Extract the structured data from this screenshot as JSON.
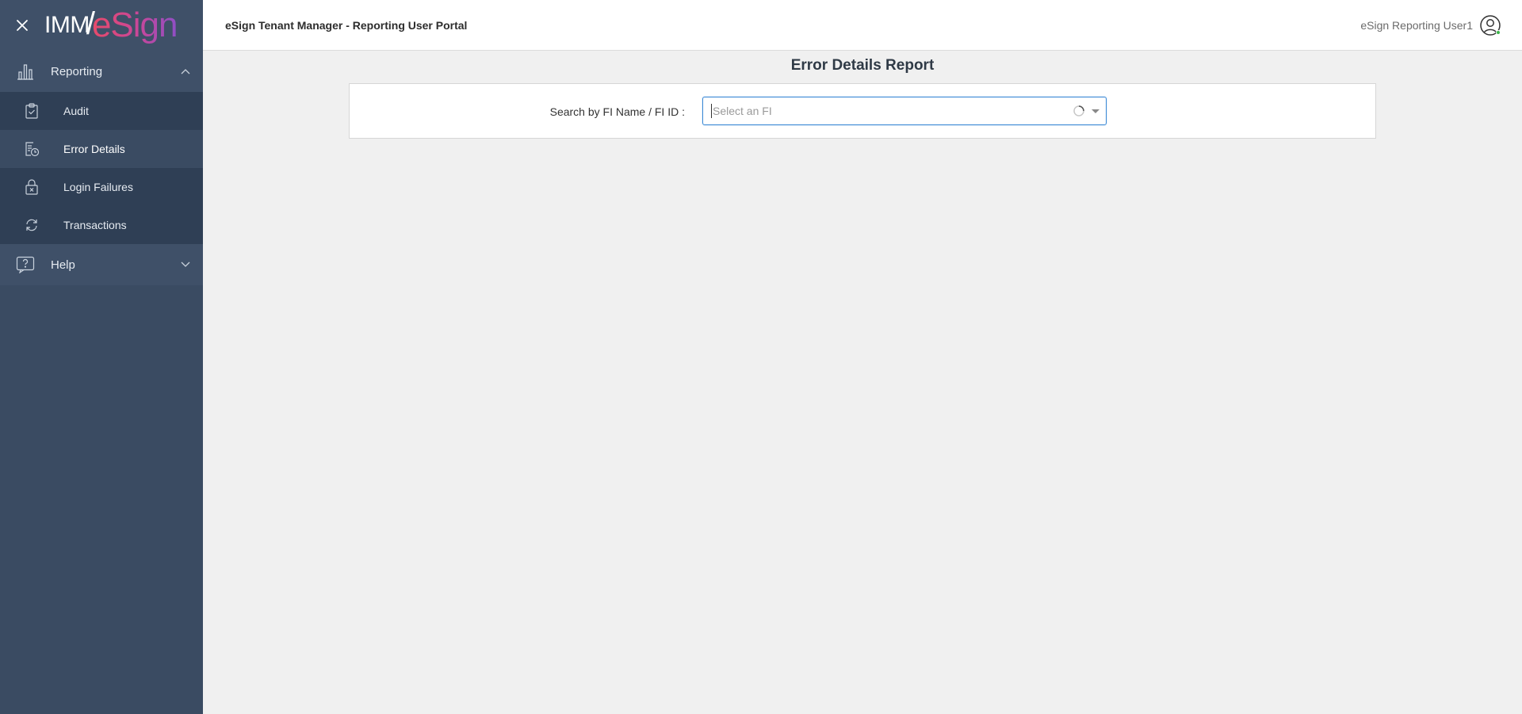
{
  "brand": {
    "logo_imm": "IMM",
    "logo_esign": "eSign"
  },
  "sidebar": {
    "groups": [
      {
        "label": "Reporting",
        "icon": "bar-chart-icon",
        "expanded": true,
        "items": [
          {
            "label": "Audit",
            "icon": "clipboard-check-icon",
            "active": false
          },
          {
            "label": "Error Details",
            "icon": "document-clock-icon",
            "active": true
          },
          {
            "label": "Login Failures",
            "icon": "lock-x-icon",
            "active": false
          },
          {
            "label": "Transactions",
            "icon": "exchange-icon",
            "active": false
          }
        ]
      },
      {
        "label": "Help",
        "icon": "question-bubble-icon",
        "expanded": false,
        "items": []
      }
    ]
  },
  "header": {
    "title": "eSign Tenant Manager - Reporting User Portal",
    "user_name": "eSign Reporting User1",
    "user_icon": "user-circle-icon"
  },
  "main": {
    "page_title": "Error Details Report",
    "search": {
      "label": "Search by FI Name / FI ID :",
      "placeholder": "Select an FI",
      "value": ""
    }
  },
  "colors": {
    "sidebar_bg": "#3a4b62",
    "sidebar_sub_bg": "#2f3f55",
    "focus_blue": "#3d8ad6",
    "status_green": "#3bb54a"
  }
}
